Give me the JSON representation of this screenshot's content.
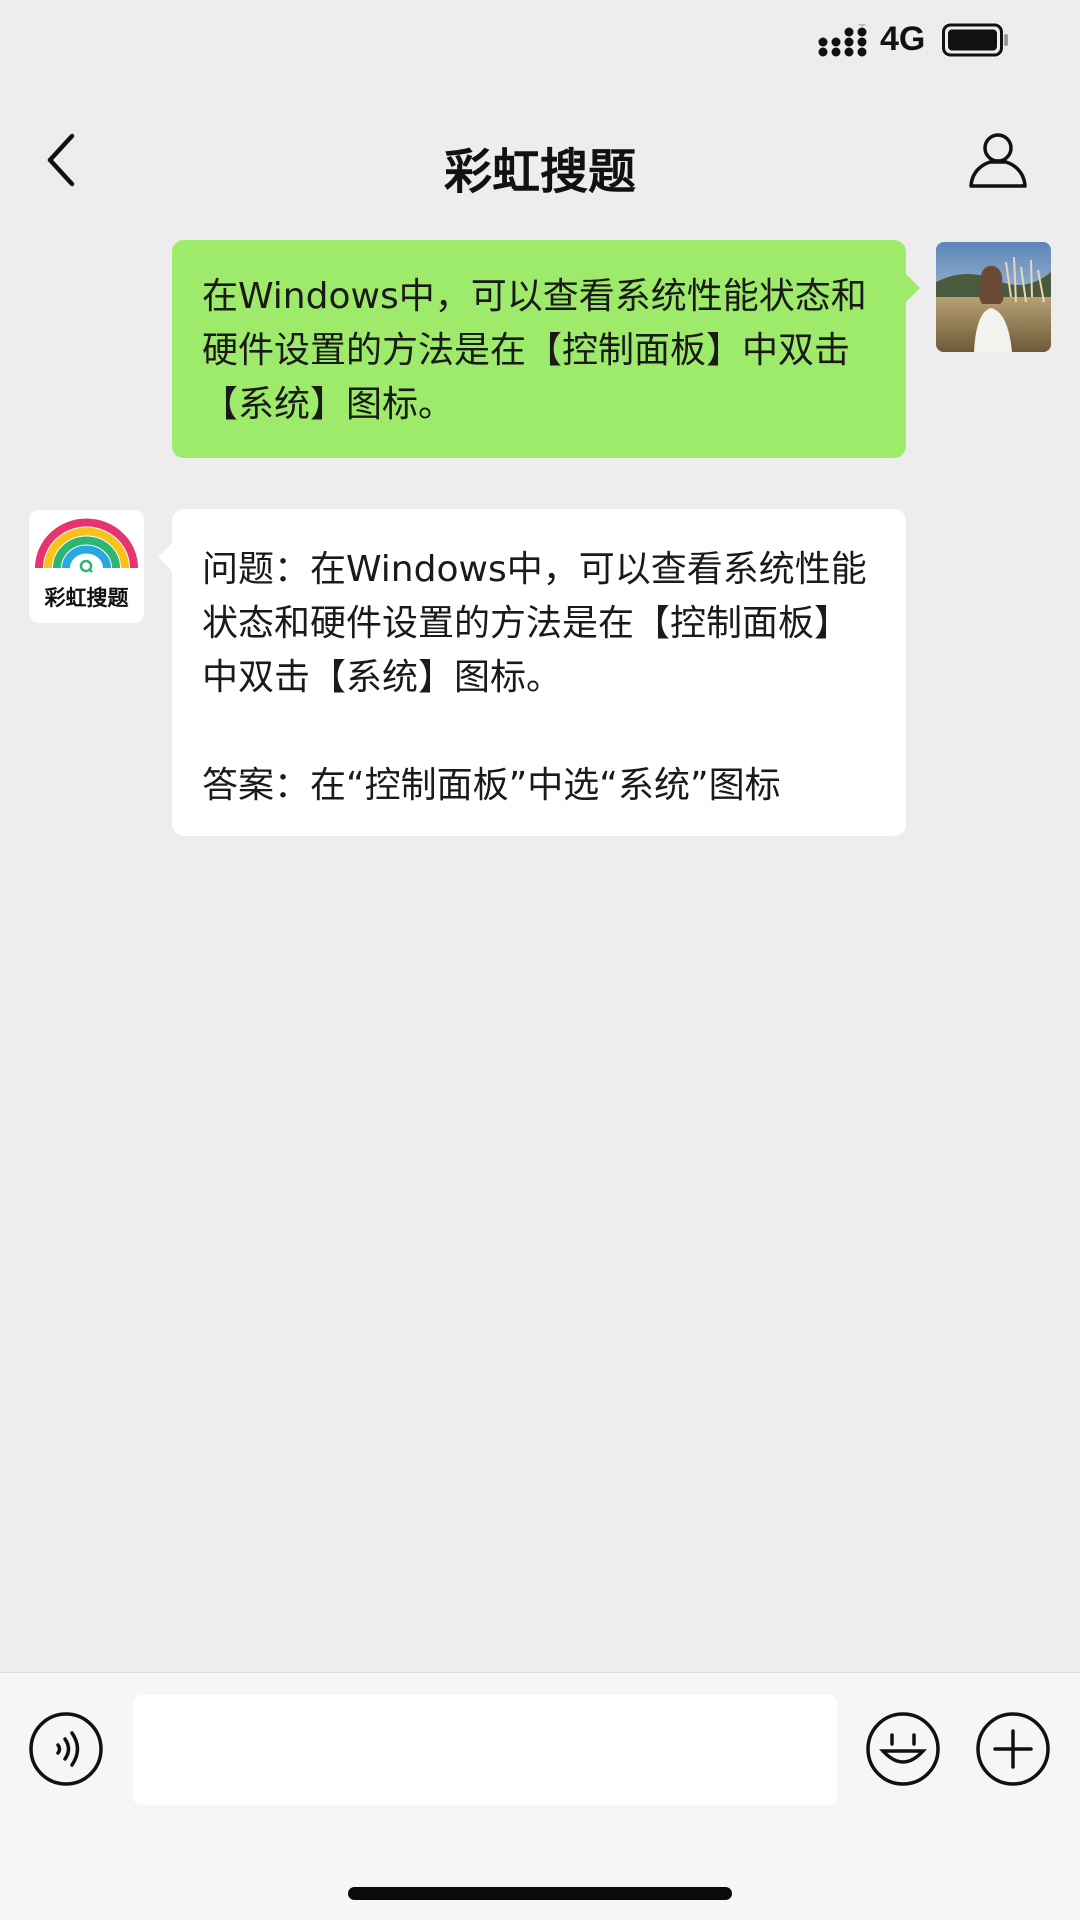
{
  "status_bar": {
    "network_type": "4G",
    "icons": [
      "signal-icon",
      "battery-icon"
    ]
  },
  "nav": {
    "title": "彩虹搜题",
    "back_icon": "chevron-left-icon",
    "profile_icon": "person-icon"
  },
  "messages": [
    {
      "sender": "user",
      "text": "在Windows中，可以查看系统性能状态和硬件设置的方法是在【控制面板】中双击【系统】图标。"
    },
    {
      "sender": "bot",
      "bot_name": "彩虹搜题",
      "question": "问题：在Windows中，可以查看系统性能状态和硬件设置的方法是在【控制面板】中双击【系统】图标。",
      "answer": "答案：在“控制面板”中选“系统”图标"
    }
  ],
  "input_bar": {
    "value": "",
    "placeholder": "",
    "icons": [
      "voice-icon",
      "emoji-icon",
      "plus-icon"
    ]
  },
  "colors": {
    "background": "#ededed",
    "user_bubble": "#9eea6a",
    "bot_bubble": "#ffffff",
    "input_bar": "#f6f6f6"
  }
}
